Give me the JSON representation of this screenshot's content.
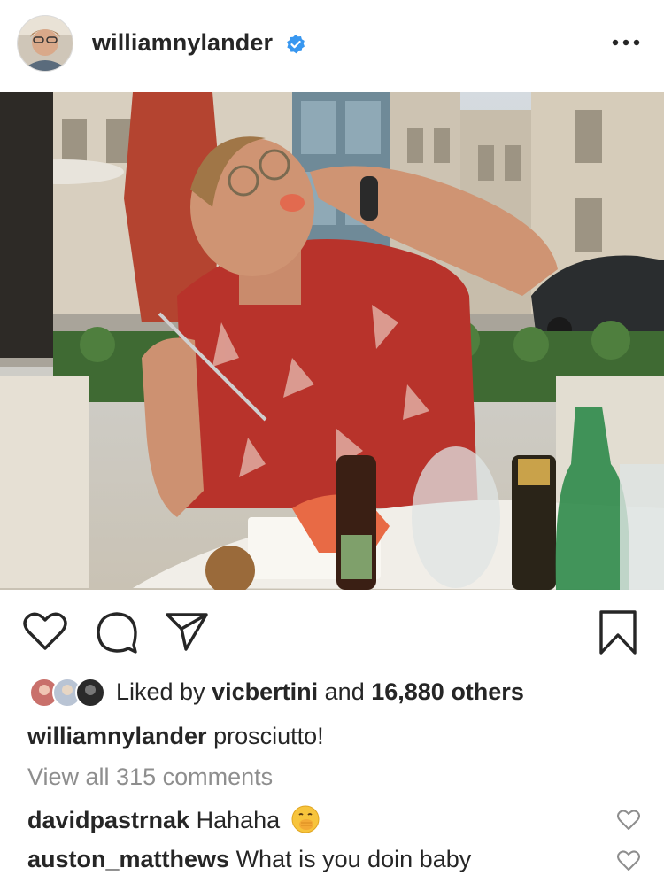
{
  "post": {
    "username": "williamnylander",
    "verified": true,
    "caption_text": "prosciutto!"
  },
  "likes": {
    "prefix": "Liked by",
    "liker": "vicbertini",
    "middle": "and",
    "others": "16,880 others"
  },
  "comments": {
    "view_all": "View all 315 comments",
    "items": [
      {
        "user": "davidpastrnak",
        "text": "Hahaha"
      },
      {
        "user": "auston_matthews",
        "text": "What is you doin baby"
      }
    ]
  },
  "icons": {
    "like": "heart-icon",
    "comment": "comment-icon",
    "share": "paper-plane-icon",
    "save": "bookmark-icon",
    "more": "more-dots-icon",
    "verified": "verified-badge-icon",
    "emoji": "hand-over-mouth-emoji"
  },
  "colors": {
    "text": "#262626",
    "muted": "#8e8e8e",
    "verified_blue": "#3897f0"
  }
}
